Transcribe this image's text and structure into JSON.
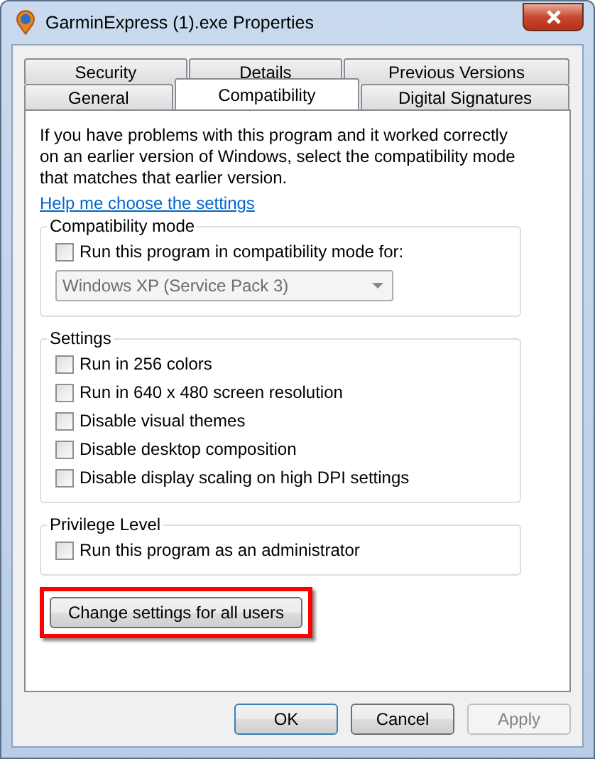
{
  "window": {
    "title": "GarminExpress (1).exe Properties"
  },
  "tab_rows": [
    [
      {
        "label": "Security",
        "selected": false
      },
      {
        "label": "Details",
        "selected": false
      },
      {
        "label": "Previous Versions",
        "selected": false
      }
    ],
    [
      {
        "label": "General",
        "selected": false
      },
      {
        "label": "Compatibility",
        "selected": true
      },
      {
        "label": "Digital Signatures",
        "selected": false
      }
    ]
  ],
  "intro": "If you have problems with this program and it worked correctly on an earlier version of Windows, select the compatibility mode that matches that earlier version.",
  "help_link": "Help me choose the settings",
  "compatibility_mode": {
    "title": "Compatibility mode",
    "option": {
      "label": "Run this program in compatibility mode for:",
      "checked": false
    },
    "dropdown": {
      "value": "Windows XP (Service Pack 3)",
      "disabled": true
    }
  },
  "settings": {
    "title": "Settings",
    "options": [
      {
        "label": "Run in 256 colors",
        "checked": false
      },
      {
        "label": "Run in 640 x 480 screen resolution",
        "checked": false
      },
      {
        "label": "Disable visual themes",
        "checked": false
      },
      {
        "label": "Disable desktop composition",
        "checked": false
      },
      {
        "label": "Disable display scaling on high DPI settings",
        "checked": false
      }
    ]
  },
  "privilege_level": {
    "title": "Privilege Level",
    "options": [
      {
        "label": "Run this program as an administrator",
        "checked": false
      }
    ]
  },
  "change_button": {
    "label": "Change settings for all users",
    "highlighted": true
  },
  "buttons": [
    {
      "label": "OK",
      "default": true,
      "disabled": false
    },
    {
      "label": "Cancel",
      "default": false,
      "disabled": false
    },
    {
      "label": "Apply",
      "default": false,
      "disabled": true
    }
  ]
}
